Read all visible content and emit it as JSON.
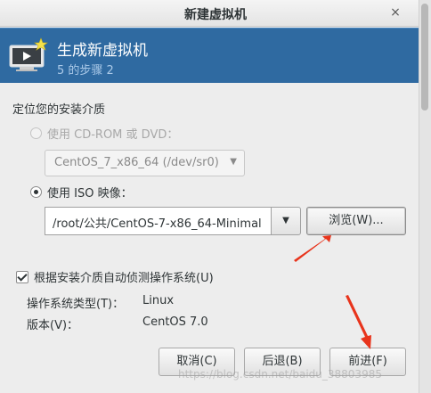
{
  "window": {
    "title": "新建虚拟机",
    "close_glyph": "×"
  },
  "header": {
    "title": "生成新虚拟机",
    "step": "5 的步骤 2",
    "icon": "vm-monitor-star-icon"
  },
  "section_label": "定位您的安装介质",
  "cdrom_option": {
    "label": "使用  CD-ROM 或  DVD：",
    "selected": false,
    "enabled": false,
    "device_value": "CentOS_7_x86_64 (/dev/sr0)"
  },
  "iso_option": {
    "label": "使用  ISO 映像：",
    "selected": true,
    "path_value": "/root/公共/CentOS-7-x86_64-Minimal",
    "browse_label": "浏览(W)..."
  },
  "autodetect": {
    "label": "根据安装介质自动侦测操作系统(U)",
    "checked": true
  },
  "os_info": {
    "type_label": "操作系统类型(T)：",
    "type_value": "Linux",
    "version_label": "版本(V)：",
    "version_value": "CentOS 7.0"
  },
  "buttons": {
    "cancel": "取消(C)",
    "back": "后退(B)",
    "forward": "前进(F)"
  },
  "watermark": "https://blog.csdn.net/baidu_38803985",
  "colors": {
    "header_bg": "#2f6aa1",
    "annotation_arrow": "#e8341c"
  }
}
